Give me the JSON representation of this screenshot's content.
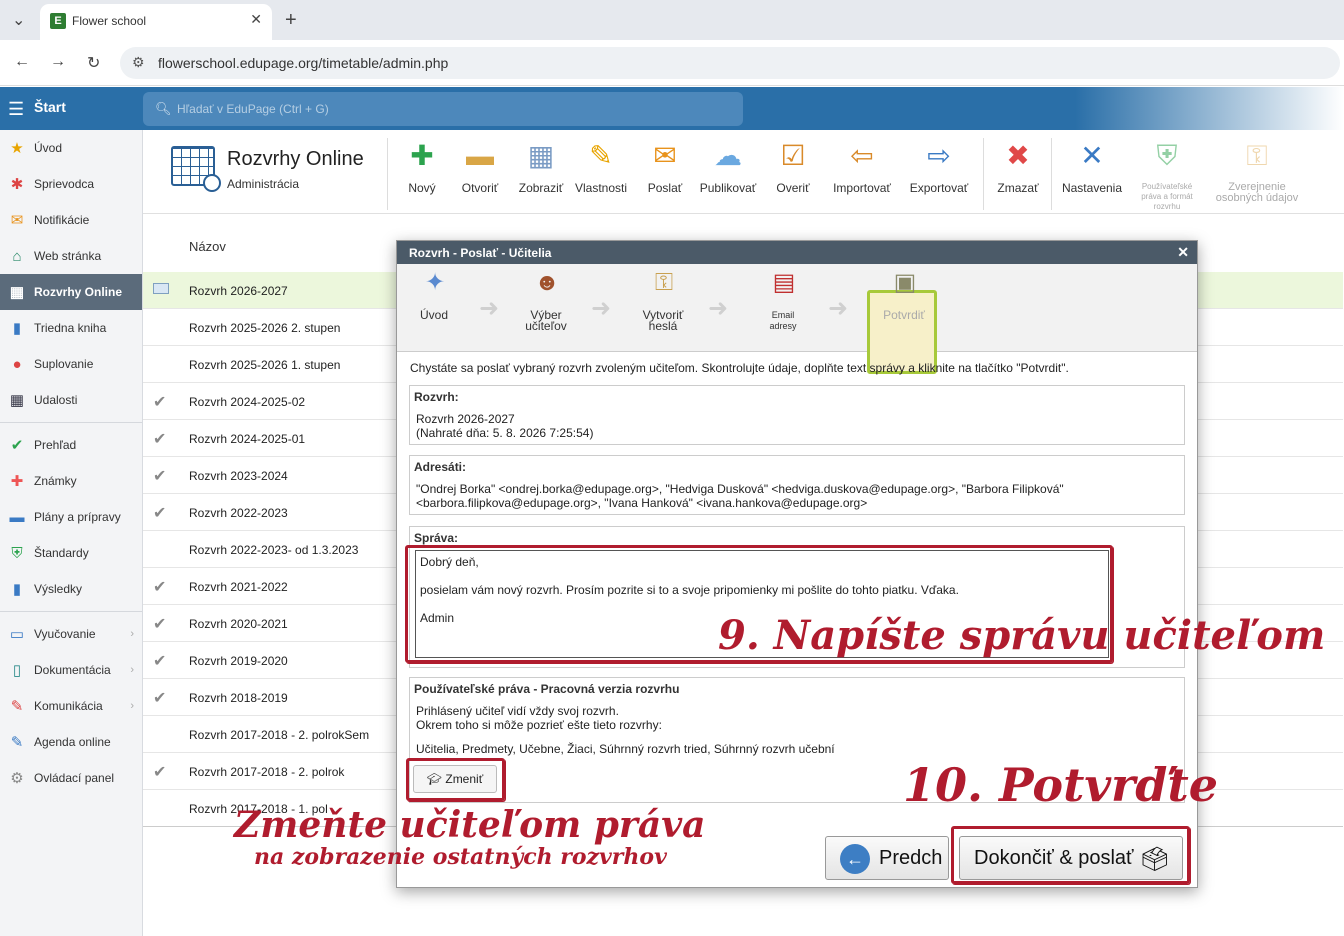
{
  "browser": {
    "tab_title": "Flower school",
    "url": "flowerschool.edupage.org/timetable/admin.php"
  },
  "topbar": {
    "start_label": "Štart",
    "search_placeholder": "Hľadať v EduPage (Ctrl + G)"
  },
  "sidebar": {
    "items": [
      {
        "label": "Úvod",
        "icon": "star-icon"
      },
      {
        "label": "Sprievodca",
        "icon": "wizard-icon"
      },
      {
        "label": "Notifikácie",
        "icon": "envelope-icon"
      },
      {
        "label": "Web stránka",
        "icon": "home-icon"
      },
      {
        "label": "Rozvrhy Online",
        "icon": "timetable-icon",
        "active": true
      },
      {
        "label": "Triedna kniha",
        "icon": "book-icon"
      },
      {
        "label": "Suplovanie",
        "icon": "person-icon"
      },
      {
        "label": "Udalosti",
        "icon": "calendar-icon"
      },
      {
        "label": "Prehľad",
        "icon": "check-circle-icon"
      },
      {
        "label": "Známky",
        "icon": "grades-icon"
      },
      {
        "label": "Plány a prípravy",
        "icon": "briefcase-icon"
      },
      {
        "label": "Štandardy",
        "icon": "shield-icon"
      },
      {
        "label": "Výsledky",
        "icon": "bar-chart-icon"
      },
      {
        "label": "Vyučovanie",
        "icon": "open-book-icon"
      },
      {
        "label": "Dokumentácia",
        "icon": "document-icon"
      },
      {
        "label": "Komunikácia",
        "icon": "chat-icon"
      },
      {
        "label": "Agenda online",
        "icon": "pen-icon"
      },
      {
        "label": "Ovládací panel",
        "icon": "gear-icon"
      }
    ]
  },
  "header": {
    "title": "Rozvrhy Online",
    "subtitle": "Administrácia"
  },
  "toolbar": [
    {
      "label": "Nový",
      "icon": "plus-icon"
    },
    {
      "label": "Otvoriť",
      "icon": "folder-icon"
    },
    {
      "label": "Zobraziť",
      "icon": "grid-icon"
    },
    {
      "label": "Vlastnosti",
      "icon": "pencil-icon"
    },
    {
      "label": "Poslať",
      "icon": "envelope-icon"
    },
    {
      "label": "Publikovať",
      "icon": "cloud-icon"
    },
    {
      "label": "Overiť",
      "icon": "verify-icon"
    },
    {
      "label": "Importovať",
      "icon": "import-icon"
    },
    {
      "label": "Exportovať",
      "icon": "export-icon"
    },
    {
      "label": "Zmazať",
      "icon": "delete-icon"
    },
    {
      "label": "Nastavenia",
      "icon": "tools-icon"
    },
    {
      "label": "Používateľské práva a formát rozvrhu",
      "icon": "shield-icon"
    },
    {
      "label": "Zverejnenie osobných údajov",
      "icon": "key-icon"
    }
  ],
  "list": {
    "header": "Názov",
    "rows": [
      {
        "name": "Rozvrh 2026-2027",
        "mark": "envelope"
      },
      {
        "name": "Rozvrh 2025-2026 2. stupen",
        "mark": ""
      },
      {
        "name": "Rozvrh 2025-2026 1. stupen",
        "mark": ""
      },
      {
        "name": "Rozvrh 2024-2025-02",
        "mark": "check"
      },
      {
        "name": "Rozvrh 2024-2025-01",
        "mark": "check"
      },
      {
        "name": "Rozvrh 2023-2024",
        "mark": "check"
      },
      {
        "name": "Rozvrh 2022-2023",
        "mark": "check"
      },
      {
        "name": "Rozvrh 2022-2023- od 1.3.2023",
        "mark": ""
      },
      {
        "name": "Rozvrh 2021-2022",
        "mark": "check"
      },
      {
        "name": "Rozvrh 2020-2021",
        "mark": "check"
      },
      {
        "name": "Rozvrh 2019-2020",
        "mark": "check"
      },
      {
        "name": "Rozvrh 2018-2019",
        "mark": "check"
      },
      {
        "name": "Rozvrh 2017-2018 - 2. polrokSem",
        "mark": ""
      },
      {
        "name": "Rozvrh 2017-2018 - 2. polrok",
        "mark": "check"
      },
      {
        "name": "Rozvrh 2017-2018 - 1. pol",
        "mark": ""
      }
    ]
  },
  "dialog": {
    "title": "Rozvrh - Poslať - Učitelia",
    "steps": [
      {
        "label": "Úvod",
        "icon": "wand-icon"
      },
      {
        "label": "Výber učiteľov",
        "icon": "users-icon"
      },
      {
        "label": "Vytvoriť heslá",
        "icon": "keys-icon"
      },
      {
        "label": "Email adresy",
        "icon": "address-book-icon"
      },
      {
        "label": "Potvrdiť",
        "icon": "stamp-icon"
      }
    ],
    "intro": "Chystáte sa poslať vybraný rozvrh zvoleným učiteľom. Skontrolujte údaje, doplňte text správy a kliknite na tlačítko \"Potvrdit\".",
    "timetable_label": "Rozvrh:",
    "timetable_name": "Rozvrh 2026-2027",
    "timetable_uploaded": "(Nahraté dňa: 5. 8. 2026 7:25:54)",
    "recipients_label": "Adresáti:",
    "recipients_line1": "\"Ondrej Borka\" <ondrej.borka@edupage.org>, \"Hedviga Dusková\" <hedviga.duskova@edupage.org>, \"Barbora Filipková\"",
    "recipients_line2": "<barbora.filipkova@edupage.org>, \"Ivana Hanková\" <ivana.hankova@edupage.org>",
    "message_label": "Správa:",
    "message_greeting": "Dobrý deň,",
    "message_body": "posielam vám nový rozvrh. Prosím pozrite si to a svoje pripomienky mi pošlite do tohto piatku. Vďaka.",
    "message_sign": "Admin",
    "rights_label": "Používateľské práva - Pracovná verzia rozvrhu",
    "rights_line1": "Prihlásený učiteľ vidí vždy svoj rozvrh.",
    "rights_line2": "Okrem toho si môže pozrieť ešte tieto rozvrhy:",
    "rights_line3": "Učitelia, Predmety, Učebne, Žiaci, Súhrnný rozvrh tried, Súhrnný rozvrh učební",
    "change_label": "Zmeniť",
    "prev_label": "Predch",
    "finish_label": "Dokončiť & poslať"
  },
  "annotations": {
    "note9": "9. Napíšte správu učiteľom",
    "note10": "10. Potvrďte",
    "note_change1": "Zmeňte učiteľom práva",
    "note_change2": "na zobrazenie ostatných rozvrhov",
    "color": "#b01c2e"
  }
}
